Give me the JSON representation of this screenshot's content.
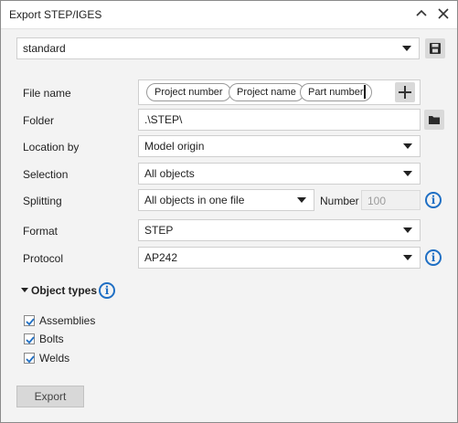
{
  "window": {
    "title": "Export STEP/IGES"
  },
  "preset": {
    "value": "standard"
  },
  "fields": {
    "file_name": {
      "label": "File name",
      "chips": [
        "Project number",
        "Project name",
        "Part number"
      ]
    },
    "folder": {
      "label": "Folder",
      "value": ".\\STEP\\"
    },
    "location_by": {
      "label": "Location by",
      "value": "Model origin"
    },
    "selection": {
      "label": "Selection",
      "value": "All objects"
    },
    "splitting": {
      "label": "Splitting",
      "value": "All objects in one file",
      "number_label": "Number",
      "number_placeholder": "100"
    },
    "format": {
      "label": "Format",
      "value": "STEP"
    },
    "protocol": {
      "label": "Protocol",
      "value": "AP242"
    }
  },
  "object_types": {
    "heading": "Object types",
    "items": [
      {
        "label": "Assemblies",
        "checked": true
      },
      {
        "label": "Bolts",
        "checked": true
      },
      {
        "label": "Welds",
        "checked": true
      }
    ]
  },
  "actions": {
    "export_label": "Export"
  },
  "icons": {
    "save": "save-icon",
    "folder": "folder-icon",
    "add": "plus-icon",
    "info": "info-icon",
    "minimize": "minimize-icon",
    "close": "close-icon"
  },
  "colors": {
    "info_blue": "#1f6fc4",
    "checkbox_check": "#1f6fc4"
  }
}
